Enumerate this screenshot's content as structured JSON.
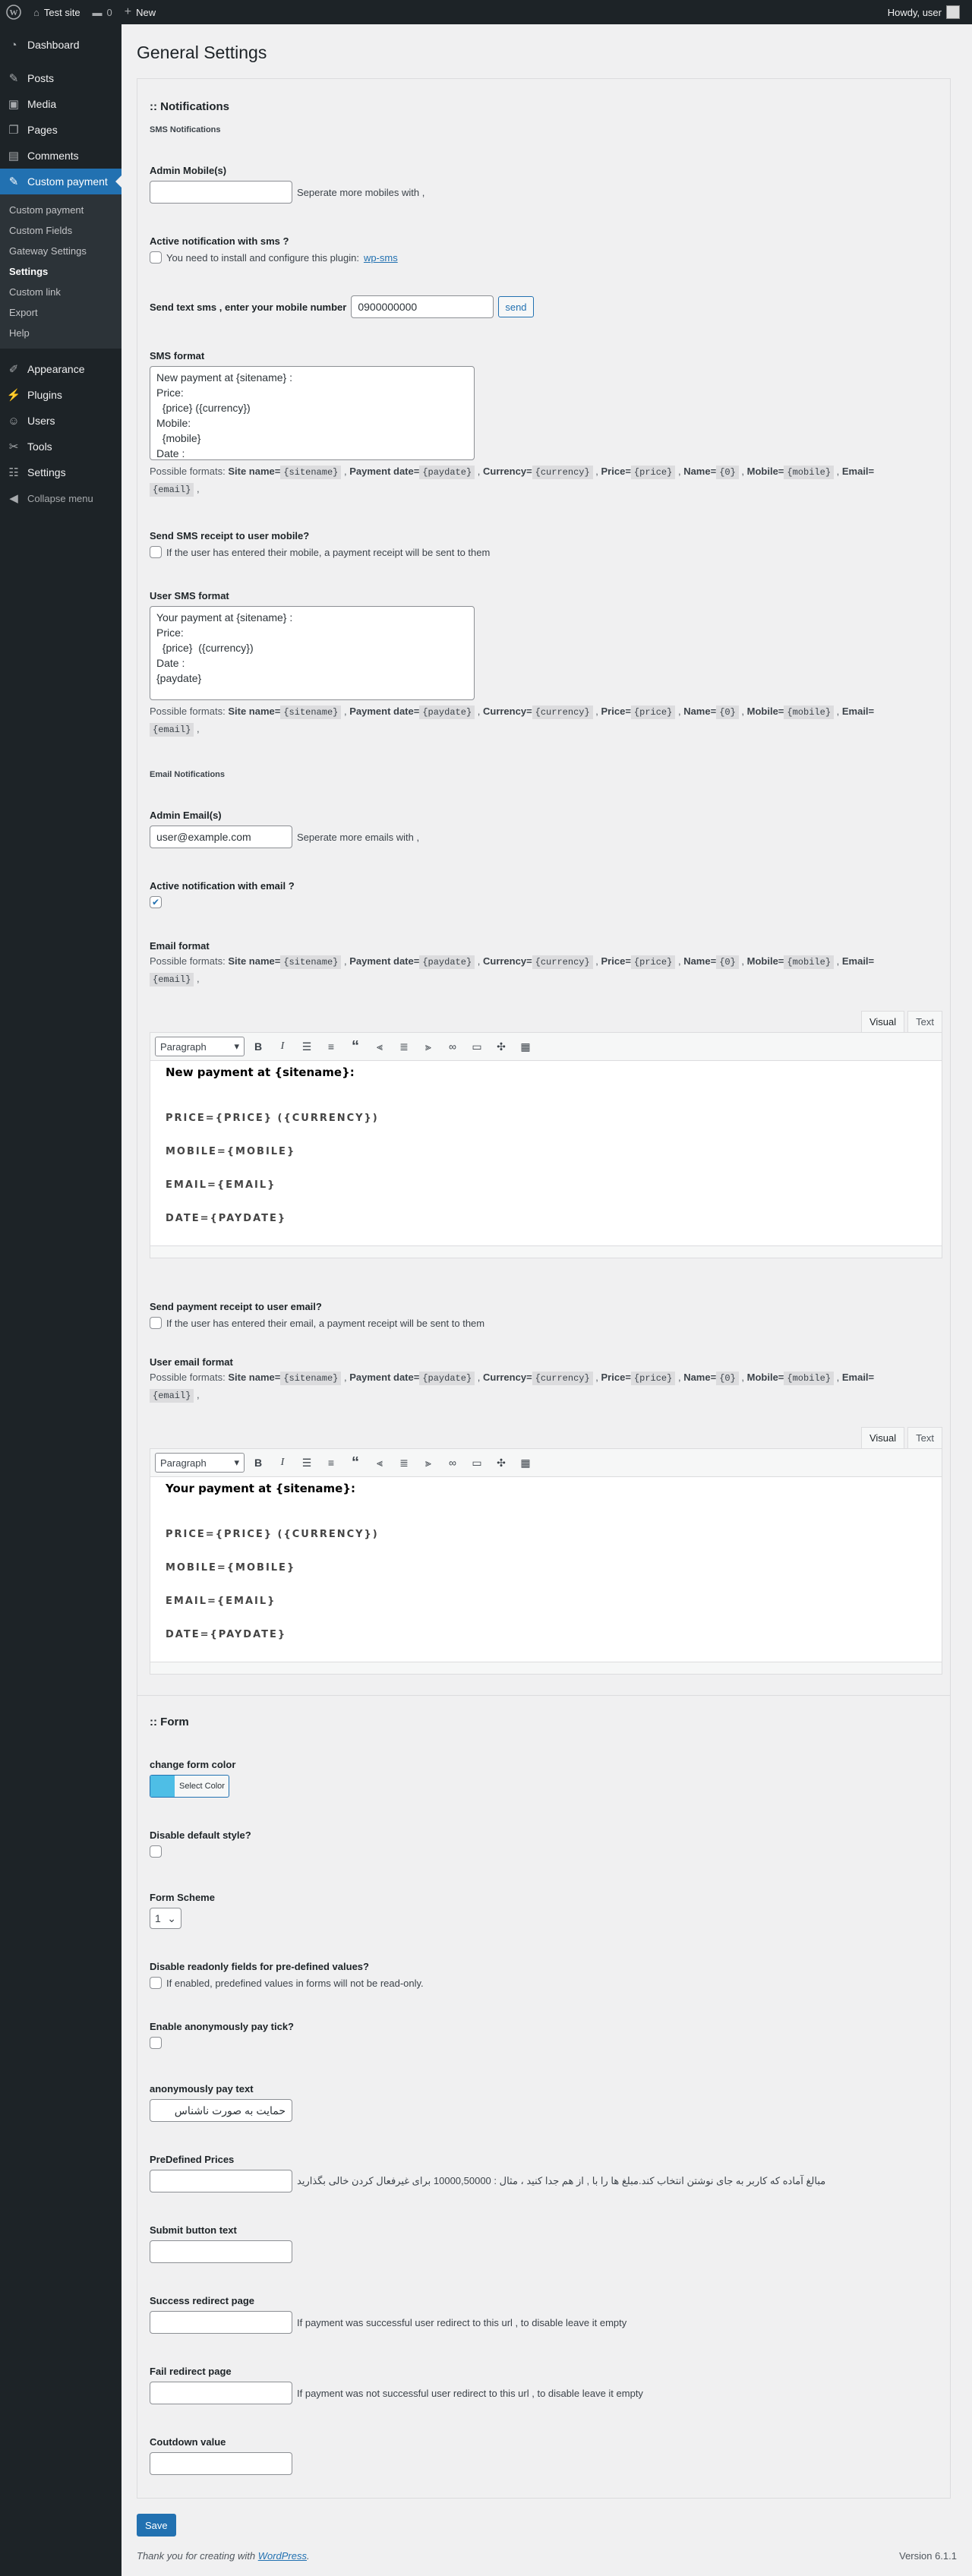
{
  "adminbar": {
    "site_name": "Test site",
    "comments_count": "0",
    "new_label": "New",
    "howdy": "Howdy, user"
  },
  "sidebar": {
    "items": [
      {
        "label": "Dashboard",
        "icon": "dashboard-icon",
        "glyph": "◔"
      },
      {
        "label": "Posts",
        "icon": "pin-icon",
        "glyph": "✎"
      },
      {
        "label": "Media",
        "icon": "media-icon",
        "glyph": "▣"
      },
      {
        "label": "Pages",
        "icon": "pages-icon",
        "glyph": "❐"
      },
      {
        "label": "Comments",
        "icon": "comment-icon",
        "glyph": "▤"
      },
      {
        "label": "Custom payment",
        "icon": "pin-icon",
        "glyph": "✎"
      },
      {
        "label": "Appearance",
        "icon": "brush-icon",
        "glyph": "✐"
      },
      {
        "label": "Plugins",
        "icon": "plugin-icon",
        "glyph": "⚡"
      },
      {
        "label": "Users",
        "icon": "users-icon",
        "glyph": "☺"
      },
      {
        "label": "Tools",
        "icon": "wrench-icon",
        "glyph": "✂"
      },
      {
        "label": "Settings",
        "icon": "settings-icon",
        "glyph": "☷"
      },
      {
        "label": "Collapse menu",
        "icon": "collapse-icon",
        "glyph": "◀"
      }
    ],
    "submenu": [
      "Custom payment",
      "Custom Fields",
      "Gateway Settings",
      "Settings",
      "Custom link",
      "Export",
      "Help"
    ]
  },
  "page_title": "General Settings",
  "notifications": {
    "heading": ":: Notifications",
    "sms_heading": "SMS Notifications",
    "admin_mobile_label": "Admin Mobile(s)",
    "admin_mobile_hint": "Seperate more mobiles with ,",
    "active_sms_label": "Active notification with sms ?",
    "active_sms_hint": "You need to install and configure this plugin:",
    "active_sms_link": "wp-sms",
    "test_sms_label": "Send text sms , enter your mobile number",
    "test_sms_value": "0900000000",
    "send_button": "send",
    "sms_format_label": "SMS format",
    "sms_format_value": "New payment at {sitename} :\nPrice:\n  {price} ({currency})\nMobile:\n  {mobile}\nDate :",
    "send_receipt_label": "Send SMS receipt to user mobile?",
    "send_receipt_hint": "If the user has entered their mobile, a payment receipt will be sent to them",
    "user_sms_label": "User SMS format",
    "user_sms_value": "Your payment at {sitename} :\nPrice:\n  {price}  ({currency})\nDate :\n{paydate}",
    "email_heading": "Email Notifications",
    "admin_email_label": "Admin Email(s)",
    "admin_email_value": "user@example.com",
    "admin_email_hint": "Seperate more emails with ,",
    "active_email_label": "Active notification with email ?",
    "email_format_label": "Email format",
    "send_email_receipt_label": "Send payment receipt to user email?",
    "send_email_receipt_hint": "If the user has entered their email, a payment receipt will be sent to them",
    "user_email_label": "User email format"
  },
  "formats": {
    "prefix": "Possible formats:",
    "items": [
      {
        "name": "Site name=",
        "code": "{sitename}"
      },
      {
        "name": "Payment date=",
        "code": "{paydate}"
      },
      {
        "name": "Currency=",
        "code": "{currency}"
      },
      {
        "name": "Price=",
        "code": "{price}"
      },
      {
        "name": "Name=",
        "code": "{0}"
      },
      {
        "name": "Mobile=",
        "code": "{mobile}"
      },
      {
        "name": "Email=",
        "code": "{email}"
      }
    ]
  },
  "editor": {
    "tab_visual": "Visual",
    "tab_text": "Text",
    "format_select": "Paragraph",
    "toolbar_icons": [
      "bold-icon",
      "italic-icon",
      "bullet-list-icon",
      "numbered-list-icon",
      "blockquote-icon",
      "align-left-icon",
      "align-center-icon",
      "align-right-icon",
      "link-icon",
      "read-more-icon",
      "fullscreen-icon",
      "toolbar-toggle-icon"
    ],
    "admin_title": "New payment at {sitename}:",
    "user_title": "Your payment at {sitename}:",
    "lines": [
      "PRICE={PRICE} ({CURRENCY})",
      "MOBILE={MOBILE}",
      "EMAIL={EMAIL}",
      "DATE={PAYDATE}"
    ]
  },
  "form": {
    "heading": ":: Form",
    "color_label": "change form color",
    "color_button": "Select Color",
    "color_value": "#4ebee6",
    "disable_style_label": "Disable default style?",
    "scheme_label": "Form Scheme",
    "scheme_value": "1",
    "readonly_label": "Disable readonly fields for pre-defined values?",
    "readonly_hint": "If enabled, predefined values in forms will not be read-only.",
    "anon_label": "Enable anonymously pay tick?",
    "anon_text_label": "anonymously pay text",
    "anon_text_value": "حمایت به صورت ناشناس",
    "predefined_label": "PreDefined Prices",
    "predefined_hint": "مبالغ آماده که کاربر به جای نوشتن انتخاب کند.مبلغ ها را با , از هم جدا کنید ، مثال : 10000,50000 برای غیرفعال کردن خالی بگذارید",
    "submit_label": "Submit button text",
    "success_label": "Success redirect page",
    "success_hint": "If payment was successful user redirect to this url , to disable leave it empty",
    "fail_label": "Fail redirect page",
    "fail_hint": "If payment was not successful user redirect to this url , to disable leave it empty",
    "countdown_label": "Coutdown value"
  },
  "save_button": "Save",
  "footer": {
    "thanks_prefix": "Thank you for creating with",
    "thanks_link": "WordPress",
    "thanks_suffix": ".",
    "version": "Version 6.1.1"
  }
}
